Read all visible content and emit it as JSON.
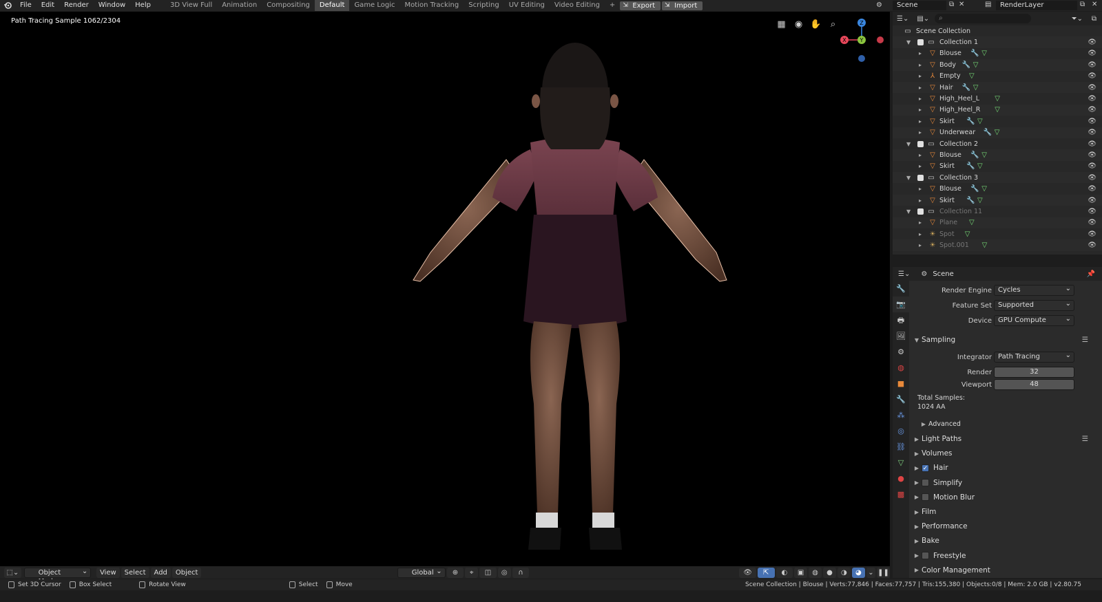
{
  "menu": [
    "File",
    "Edit",
    "Render",
    "Window",
    "Help"
  ],
  "workspaces": [
    "3D View Full",
    "Animation",
    "Compositing",
    "Default",
    "Game Logic",
    "Motion Tracking",
    "Scripting",
    "UV Editing",
    "Video Editing"
  ],
  "active_workspace": "Default",
  "top_buttons": {
    "export": "Export",
    "import": "Import"
  },
  "scene_name": "Scene",
  "view_layer": "RenderLayer",
  "viewport": {
    "status": "Path Tracing Sample 1062/2304",
    "gizmo": {
      "x": "X",
      "y": "Y",
      "z": "Z"
    },
    "colors": {
      "x": "#e8475a",
      "y": "#8bc53f",
      "z": "#3a87e0",
      "neg_x": "#c73a49",
      "neg_z": "#2f5fa8"
    }
  },
  "vp_header": {
    "mode": "Object Mode",
    "menus": [
      "View",
      "Select",
      "Add",
      "Object"
    ],
    "orientation": "Global"
  },
  "statusbar": {
    "hints": [
      "Set 3D Cursor",
      "Box Select",
      "Rotate View",
      "Select",
      "Move"
    ],
    "info": "Scene Collection | Blouse | Verts:77,846 | Faces:77,757 | Tris:155,380 | Objects:0/8 | Mem: 2.0 GB | v2.80.75"
  },
  "outliner": {
    "root": "Scene Collection",
    "rows": [
      {
        "type": "collection",
        "label": "Collection 1"
      },
      {
        "type": "mesh",
        "label": "Blouse",
        "mods": true
      },
      {
        "type": "mesh",
        "label": "Body",
        "mods": true
      },
      {
        "type": "empty",
        "label": "Empty",
        "mods": false
      },
      {
        "type": "mesh",
        "label": "Hair",
        "mods": true
      },
      {
        "type": "mesh",
        "label": "High_Heel_L",
        "mods": false
      },
      {
        "type": "mesh",
        "label": "High_Heel_R",
        "mods": false
      },
      {
        "type": "mesh",
        "label": "Skirt",
        "mods": true
      },
      {
        "type": "mesh",
        "label": "Underwear",
        "mods": true
      },
      {
        "type": "collection",
        "label": "Collection 2"
      },
      {
        "type": "mesh",
        "label": "Blouse",
        "mods": true
      },
      {
        "type": "mesh",
        "label": "Skirt",
        "mods": true
      },
      {
        "type": "collection",
        "label": "Collection 3"
      },
      {
        "type": "mesh",
        "label": "Blouse",
        "mods": true
      },
      {
        "type": "mesh",
        "label": "Skirt",
        "mods": true
      },
      {
        "type": "collection",
        "label": "Collection 11",
        "dim": true
      },
      {
        "type": "mesh",
        "label": "Plane",
        "mods": false,
        "dim": true
      },
      {
        "type": "light",
        "label": "Spot",
        "mods": false,
        "dim": true
      },
      {
        "type": "light",
        "label": "Spot.001",
        "mods": false,
        "dim": true
      }
    ]
  },
  "properties": {
    "context": "Scene",
    "render_engine_label": "Render Engine",
    "render_engine": "Cycles",
    "feature_set_label": "Feature Set",
    "feature_set": "Supported",
    "device_label": "Device",
    "device": "GPU Compute",
    "sampling": "Sampling",
    "integrator_label": "Integrator",
    "integrator": "Path Tracing",
    "render_label": "Render",
    "render_samples": "32",
    "viewport_label": "Viewport",
    "viewport_samples": "48",
    "total_label": "Total Samples:",
    "total_value": "1024 AA",
    "advanced": "Advanced",
    "panels": [
      {
        "label": "Light Paths",
        "check": null
      },
      {
        "label": "Volumes",
        "check": null
      },
      {
        "label": "Hair",
        "check": true
      },
      {
        "label": "Simplify",
        "check": false
      },
      {
        "label": "Motion Blur",
        "check": false
      },
      {
        "label": "Film",
        "check": null
      },
      {
        "label": "Performance",
        "check": null
      },
      {
        "label": "Bake",
        "check": null
      },
      {
        "label": "Freestyle",
        "check": false
      },
      {
        "label": "Color Management",
        "check": null
      }
    ]
  }
}
